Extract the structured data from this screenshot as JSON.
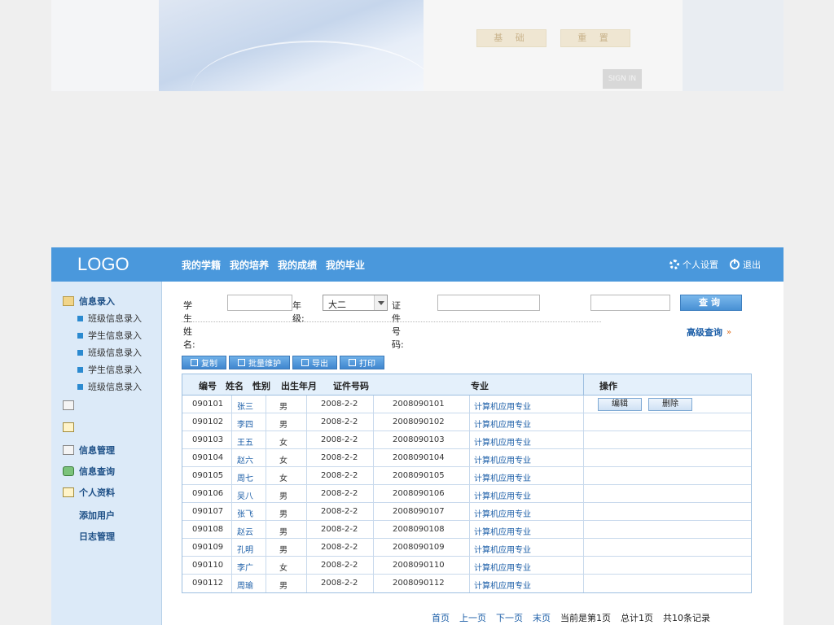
{
  "top_preview": {
    "btn1": "基 础",
    "btn2": "重 置",
    "small": "SIGN IN"
  },
  "header": {
    "logo": "LOGO",
    "nav": [
      "我的学籍",
      "我的培养",
      "我的成绩",
      "我的毕业"
    ],
    "settings": "个人设置",
    "logout": "退出"
  },
  "sidebar": {
    "group_entry": "信息录入",
    "sub_items": [
      "班级信息录入",
      "学生信息录入",
      "班级信息录入",
      "学生信息录入",
      "班级信息录入"
    ],
    "info_manage": "信息管理",
    "info_query": "信息查询",
    "profile": "个人资料",
    "add_user": "添加用户",
    "log_manage": "日志管理"
  },
  "search": {
    "name_label": "学生姓名:",
    "grade_label": "年级:",
    "grade_value": "大二",
    "id_label": "证件号码:",
    "query_button": "查询",
    "advanced": "高级查询"
  },
  "toolbar": {
    "copy": "复制",
    "batch": "批量维护",
    "export": "导出",
    "print": "打印"
  },
  "table": {
    "headers": {
      "id": "编号",
      "name": "姓名",
      "gender": "性别",
      "birth": "出生年月",
      "cert": "证件号码",
      "major": "专业",
      "ops": "操作"
    },
    "edit": "编辑",
    "delete": "删除",
    "rows": [
      {
        "id": "090101",
        "name": "张三",
        "gender": "男",
        "birth": "2008-2-2",
        "cert": "2008090101",
        "major": "计算机应用专业"
      },
      {
        "id": "090102",
        "name": "李四",
        "gender": "男",
        "birth": "2008-2-2",
        "cert": "2008090102",
        "major": "计算机应用专业"
      },
      {
        "id": "090103",
        "name": "王五",
        "gender": "女",
        "birth": "2008-2-2",
        "cert": "2008090103",
        "major": "计算机应用专业"
      },
      {
        "id": "090104",
        "name": "赵六",
        "gender": "女",
        "birth": "2008-2-2",
        "cert": "2008090104",
        "major": "计算机应用专业"
      },
      {
        "id": "090105",
        "name": "周七",
        "gender": "女",
        "birth": "2008-2-2",
        "cert": "2008090105",
        "major": "计算机应用专业"
      },
      {
        "id": "090106",
        "name": "吴八",
        "gender": "男",
        "birth": "2008-2-2",
        "cert": "2008090106",
        "major": "计算机应用专业"
      },
      {
        "id": "090107",
        "name": "张飞",
        "gender": "男",
        "birth": "2008-2-2",
        "cert": "2008090107",
        "major": "计算机应用专业"
      },
      {
        "id": "090108",
        "name": "赵云",
        "gender": "男",
        "birth": "2008-2-2",
        "cert": "2008090108",
        "major": "计算机应用专业"
      },
      {
        "id": "090109",
        "name": "孔明",
        "gender": "男",
        "birth": "2008-2-2",
        "cert": "2008090109",
        "major": "计算机应用专业"
      },
      {
        "id": "090110",
        "name": "李广",
        "gender": "女",
        "birth": "2008-2-2",
        "cert": "2008090110",
        "major": "计算机应用专业"
      },
      {
        "id": "090112",
        "name": "周瑜",
        "gender": "男",
        "birth": "2008-2-2",
        "cert": "2008090112",
        "major": "计算机应用专业"
      }
    ]
  },
  "pager": {
    "first": "首页",
    "prev": "上一页",
    "next": "下一页",
    "last": "末页",
    "current": "当前是第1页",
    "total_pages": "总计1页",
    "total_records": "共10条记录"
  }
}
